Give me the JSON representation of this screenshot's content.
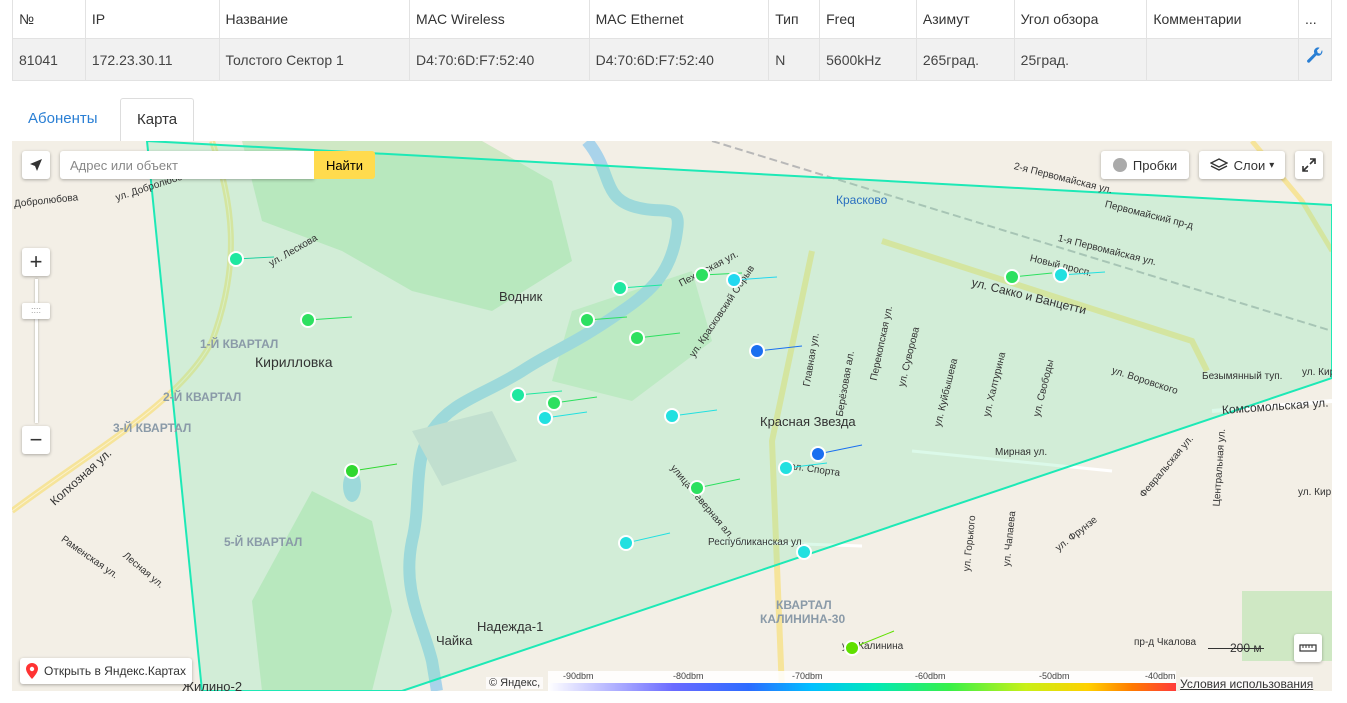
{
  "table": {
    "headers": [
      "№",
      "IP",
      "Название",
      "MAC Wireless",
      "MAC Ethernet",
      "Тип",
      "Freq",
      "Азимут",
      "Угол обзора",
      "Комментарии",
      "..."
    ],
    "row": [
      "81041",
      "172.23.30.11",
      "Толстого Сектор 1",
      "D4:70:6D:F7:52:40",
      "D4:70:6D:F7:52:40",
      "N",
      "5600kHz",
      "265град.",
      "25град.",
      ""
    ],
    "action_icon": "wrench-icon"
  },
  "tabs": [
    {
      "label": "Абоненты",
      "active": false
    },
    {
      "label": "Карта",
      "active": true
    }
  ],
  "map": {
    "search_placeholder": "Адрес или объект",
    "search_button": "Найти",
    "traffic_label": "Пробки",
    "layers_label": "Слои",
    "zoom_in": "+",
    "zoom_out": "−",
    "open_in_yandex": "Открыть в Яндекс.Картах",
    "scale_label": "200 м",
    "copyright": "© Яндекс,",
    "terms": "Условия использования",
    "legend": [
      "-90dbm",
      "-80dbm",
      "-70dbm",
      "-60dbm",
      "-50dbm",
      "-40dbm"
    ],
    "place_labels": [
      "Водник",
      "Кирилловка",
      "Красная Звезда",
      "Надежда-1",
      "Чайка",
      "Жилино-2",
      "Красково"
    ],
    "quarter_labels": [
      "1-Й КВАРТАЛ",
      "2-Й КВАРТАЛ",
      "3-Й КВАРТАЛ",
      "5-Й КВАРТАЛ",
      "КВАРТАЛ",
      "КАЛИНИНА-30"
    ],
    "street_labels": [
      "ул. Сакко и Ванцетти",
      "Комсомольская ул.",
      "Республиканская ул.",
      "ул. Калинина",
      "Мирная ул.",
      "ул. Воровского",
      "Безымянный туп.",
      "Первомайский пр-д",
      "1-я Первомайская ул.",
      "2-я Первомайская ул.",
      "Новый просп.",
      "ул. Суворова",
      "ул. Куйбышева",
      "ул. Халтурина",
      "ул. Свободы",
      "Главная ул.",
      "Берёзовая ал.",
      "Перекопская ул.",
      "ул. Красковский Обрыв",
      "Пехорская ул.",
      "ул. Лескова",
      "Колхозная ул.",
      "Раменская ул.",
      "Лесная ул.",
      "Февральская ул.",
      "Центральная ул.",
      "ул. Фрунзе",
      "ул. Чапаева",
      "ул. Горького",
      "Добролюбова",
      "ул. Добролюбова",
      "улица Северная ал.",
      "ал. Спорта",
      "пр-д Чкалова",
      "ул. Кир",
      "ул. Кир"
    ]
  },
  "colors": {
    "link": "#2a7fd4",
    "find_button": "#ffdb4d",
    "sector": "#1de9b6"
  }
}
